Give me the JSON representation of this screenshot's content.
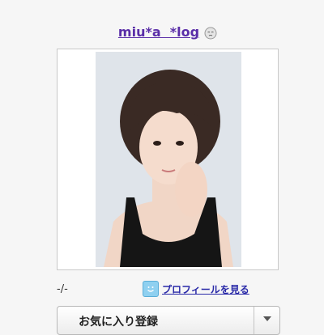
{
  "header": {
    "blog_title": "miu*a  *log",
    "title_icon": "sleepy-face-icon"
  },
  "profile": {
    "photo_icon": "profile-photo",
    "status": "-/-",
    "link_icon": "smiley-face-icon",
    "link_label": "プロフィールを見る"
  },
  "actions": {
    "favorite_label": "お気に入り登録",
    "dropdown_icon": "caret-down-icon"
  },
  "colors": {
    "title": "#5a2ea8",
    "link": "#2a2aa8",
    "frame_border": "#c9c9c9",
    "background": "#f6f6f6"
  }
}
